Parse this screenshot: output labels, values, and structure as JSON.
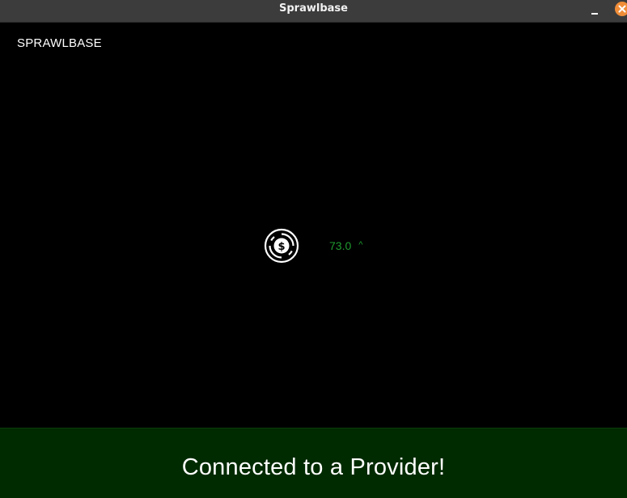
{
  "window": {
    "title": "Sprawlbase",
    "controls": {
      "minimize_icon": "minimize-icon",
      "close_icon": "close-icon",
      "close_color": "#f08d38"
    }
  },
  "app": {
    "brand": "SPRAWLBASE"
  },
  "balance": {
    "icon": "dollar-coin-icon",
    "value": "73.0",
    "trend_symbol": "^",
    "color": "#1f9a2f"
  },
  "status": {
    "message": "Connected to a Provider!",
    "background": "#002a00"
  }
}
